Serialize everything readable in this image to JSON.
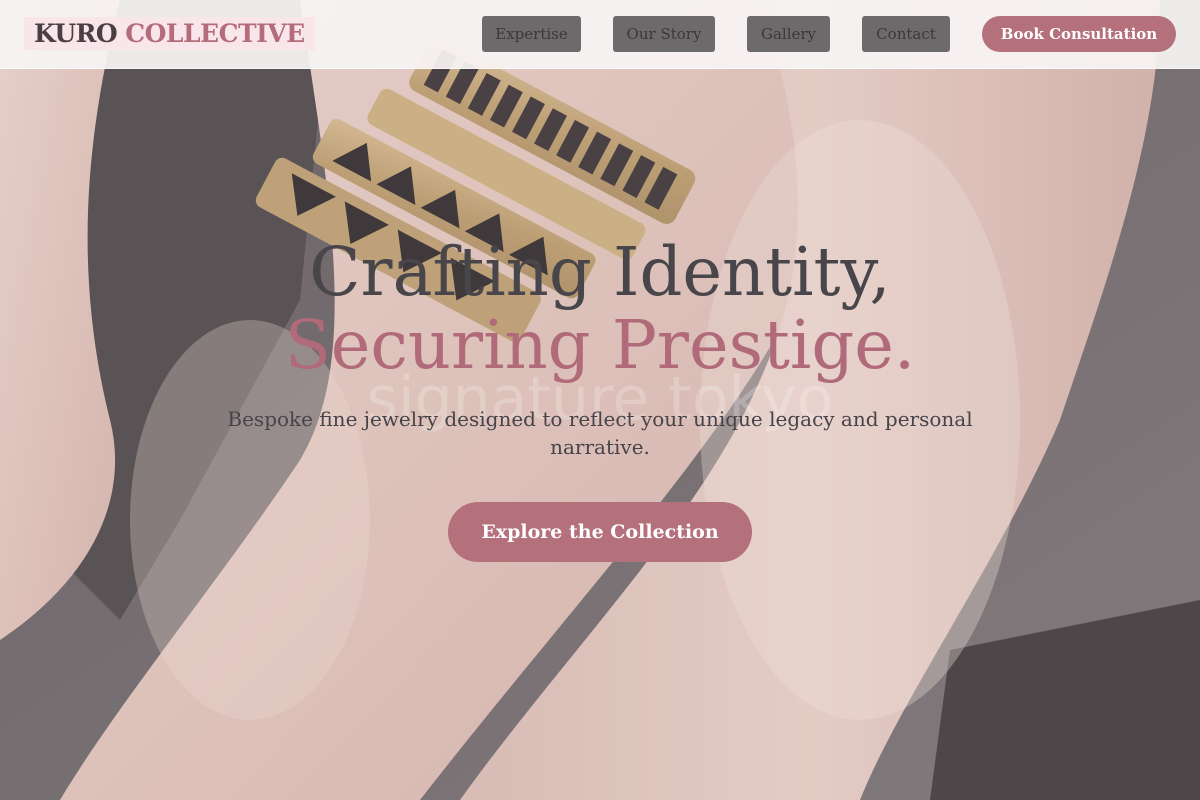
{
  "brand": {
    "part1": "KURO",
    "part2": "COLLECTIVE"
  },
  "nav": {
    "links": [
      {
        "label": "Expertise"
      },
      {
        "label": "Our Story"
      },
      {
        "label": "Gallery"
      },
      {
        "label": "Contact"
      }
    ],
    "cta_label": "Book Consultation"
  },
  "hero": {
    "headline_line1": "Crafting Identity,",
    "headline_line2": "Securing Prestige.",
    "watermark": "signature tokyo",
    "subtext": "Bespoke fine jewelry designed to reflect your unique legacy and personal narrative.",
    "cta_label": "Explore the Collection"
  },
  "colors": {
    "accent": "#b4707b",
    "headline_dark": "#48464a",
    "headline_accent": "#b06a79",
    "logo_bg": "#f9e6ea",
    "nav_link_bg": "#6c6a6b"
  },
  "icons": [
    "bracelet-photo"
  ]
}
